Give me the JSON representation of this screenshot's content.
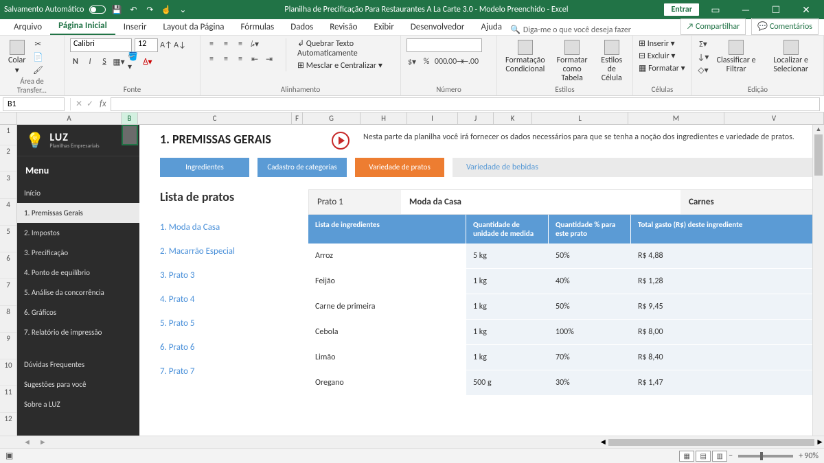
{
  "titlebar": {
    "autosave": "Salvamento Automático",
    "title": "Planilha de Precificação Para Restaurantes A La Carte 3.0 - Modelo Preenchido  -  Excel",
    "signin": "Entrar"
  },
  "menu": {
    "file": "Arquivo",
    "home": "Página Inicial",
    "insert": "Inserir",
    "layout": "Layout da Página",
    "formulas": "Fórmulas",
    "data": "Dados",
    "review": "Revisão",
    "view": "Exibir",
    "dev": "Desenvolvedor",
    "help": "Ajuda",
    "tellme": "Diga-me o que você deseja fazer",
    "share": "Compartilhar",
    "comments": "Comentários"
  },
  "ribbon": {
    "groups": {
      "clipboard": "Área de Transfer...",
      "font": "Fonte",
      "alignment": "Alinhamento",
      "number": "Número",
      "styles": "Estilos",
      "cells": "Células",
      "editing": "Edição"
    },
    "paste": "Colar",
    "font_name": "Calibri",
    "font_size": "12",
    "wrap": "Quebrar Texto Automaticamente",
    "merge": "Mesclar e Centralizar",
    "condfmt": "Formatação Condicional",
    "fmttable": "Formatar como Tabela",
    "cellstyles": "Estilos de Célula",
    "insert": "Inserir",
    "delete": "Excluir",
    "format": "Formatar",
    "sort": "Classificar e Filtrar",
    "find": "Localizar e Selecionar"
  },
  "namebox": "B1",
  "side": {
    "logo_name": "LUZ",
    "logo_sub": "Planilhas Empresariais",
    "menu": "Menu",
    "home": "Início",
    "items": [
      "1. Premissas Gerais",
      "2. Impostos",
      "3. Precificação",
      "4. Ponto de equilíbrio",
      "5. Análise da concorrência",
      "6. Gráficos",
      "7. Relatório de impressão"
    ],
    "faq": "Dúvidas Frequentes",
    "sug": "Sugestões para você",
    "about": "Sobre a LUZ"
  },
  "content": {
    "h1": "1. PREMISSAS GERAIS",
    "desc": "Nesta parte da planilha você irá fornecer os dados necessários para que se tenha a noção dos ingredientes e variedade de pratos.",
    "tabs": [
      "Ingredientes",
      "Cadastro de categorias",
      "Variedade de pratos",
      "Variedade de bebidas"
    ],
    "list_title": "Lista de pratos",
    "dishes": [
      "1. Moda da Casa",
      "2. Macarrão Especial",
      "3. Prato 3",
      "4. Prato 4",
      "5. Prato 5",
      "6. Prato 6",
      "7. Prato 7"
    ],
    "prato_label": "Prato 1",
    "prato_name": "Moda da Casa",
    "cat_name": "Carnes",
    "headers": [
      "Lista de ingredientes",
      "Quantidade de unidade de medida",
      "Quantidade % para este prato",
      "Total gasto (R$) deste ingrediente"
    ],
    "rows": [
      {
        "ing": "Arroz",
        "qty": "5 kg",
        "pct": "50%",
        "cost": "R$ 4,88"
      },
      {
        "ing": "Feijão",
        "qty": "1 kg",
        "pct": "40%",
        "cost": "R$ 1,28"
      },
      {
        "ing": "Carne de primeira",
        "qty": "1 kg",
        "pct": "50%",
        "cost": "R$ 9,45"
      },
      {
        "ing": "Cebola",
        "qty": "1 kg",
        "pct": "100%",
        "cost": "R$ 8,00"
      },
      {
        "ing": "Limão",
        "qty": "1 kg",
        "pct": "70%",
        "cost": "R$ 8,40"
      },
      {
        "ing": "Oregano",
        "qty": "500 g",
        "pct": "30%",
        "cost": "R$ 1,47"
      }
    ]
  },
  "status": {
    "zoom": "90%"
  }
}
